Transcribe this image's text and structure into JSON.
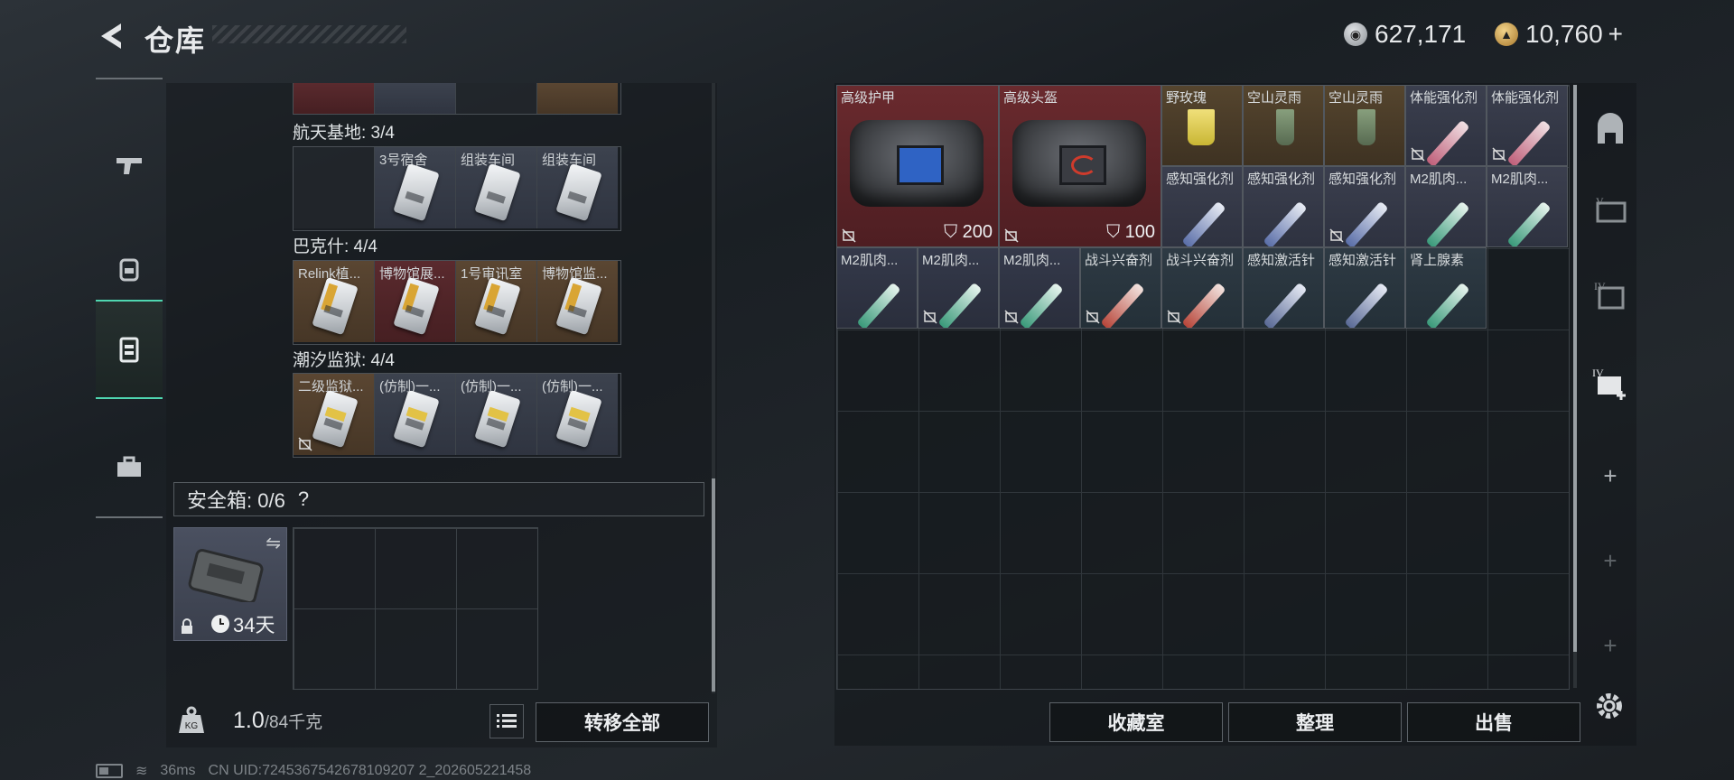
{
  "header": {
    "title": "仓库",
    "currency1": "627,171",
    "currency2": "10,760",
    "plus": "+"
  },
  "left_nav": [
    "gun-icon",
    "backpack-icon",
    "storage-icon",
    "toolbox-icon"
  ],
  "zones": [
    {
      "name": "航天基地: 3/4",
      "items": [
        "",
        "3号宿舍",
        "组装车间",
        "组装车间"
      ]
    },
    {
      "name": "巴克什: 4/4",
      "items": [
        "Relink植...",
        "博物馆展...",
        "1号审讯室",
        "博物馆监..."
      ]
    },
    {
      "name": "潮汐监狱: 4/4",
      "items": [
        "二级监狱...",
        "(仿制)一...",
        "(仿制)一...",
        "(仿制)一..."
      ]
    }
  ],
  "safebox": {
    "label": "安全箱: 0/6",
    "help": "?",
    "days": "34天"
  },
  "weight": {
    "value": "1.0",
    "max": "/84千克"
  },
  "buttons": {
    "transfer": "转移全部",
    "collection": "收藏室",
    "sort": "整理",
    "sell": "出售"
  },
  "stash": {
    "armor": {
      "label": "高级护甲",
      "durability": "200"
    },
    "helmet": {
      "label": "高级头盔",
      "durability": "100"
    },
    "row1": [
      "野玫瑰",
      "空山灵雨",
      "空山灵雨",
      "体能强化剂",
      "体能强化剂"
    ],
    "row2": [
      "感知强化剂",
      "感知强化剂",
      "感知强化剂",
      "M2肌肉...",
      "M2肌肉..."
    ],
    "row3": [
      "M2肌肉...",
      "M2肌肉...",
      "M2肌肉...",
      "战斗兴奋剂",
      "战斗兴奋剂",
      "感知激活针",
      "感知激活针",
      "肾上腺素"
    ]
  },
  "status": {
    "ping": "36ms",
    "uid": "CN UID:7245367542678109207 2_202605221458"
  }
}
